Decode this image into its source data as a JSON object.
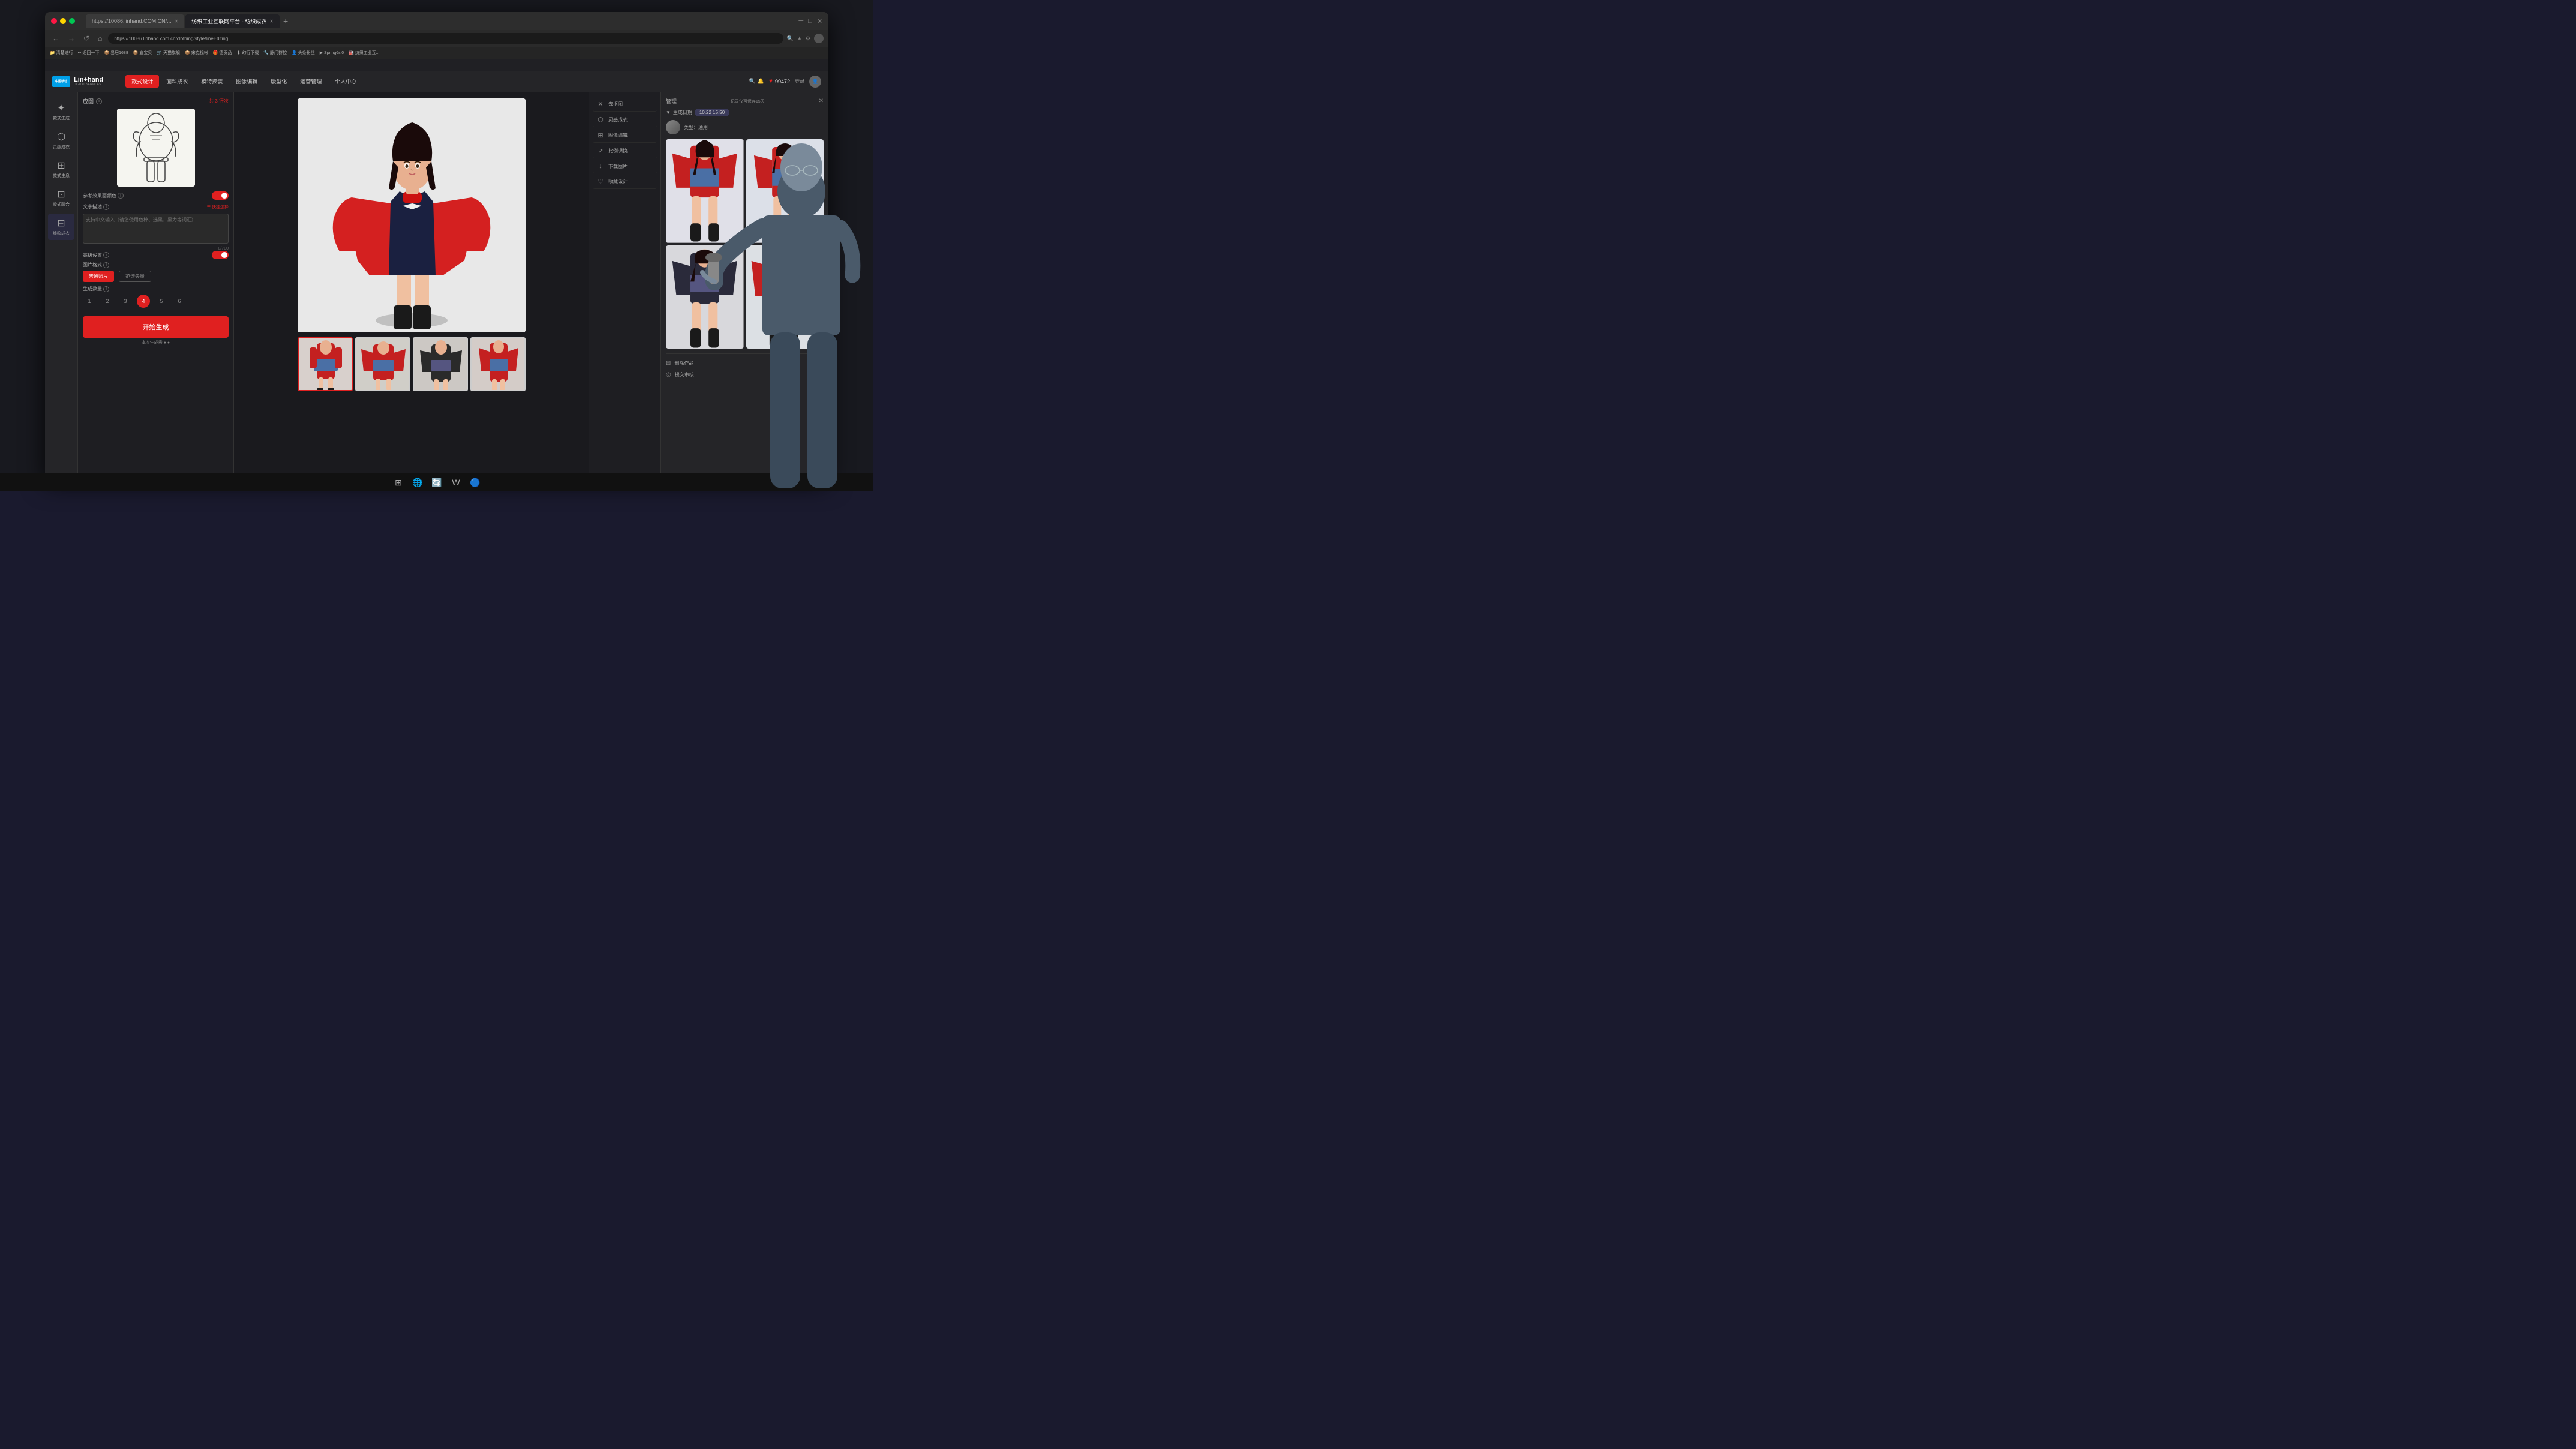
{
  "browser": {
    "tabs": [
      {
        "id": 1,
        "label": "https://10086.linhand.COM.CN/...",
        "active": false
      },
      {
        "id": 2,
        "label": "纺织工业互联网平台 - 纺织成衣",
        "active": true
      },
      {
        "id": 3,
        "label": "",
        "active": false
      }
    ],
    "address": "https://10086.linhand.com.cn/clothing/style/lineEditing",
    "bookmarks": [
      "清除进行",
      "返回一下",
      "易居1688",
      "宜宝贝",
      "天猫旗舰",
      "宋克视帐",
      "德贡品",
      "幻行下载",
      "脉门群控",
      "头条粉丝",
      "Spring6sl0",
      "纺织工业互..."
    ]
  },
  "app": {
    "logo_mobile": "中国移动",
    "logo_name": "Lin+hand",
    "logo_subtitle": "DIGITAL SERVICES",
    "nav_items": [
      {
        "label": "款式设计",
        "active": true
      },
      {
        "label": "面料成衣",
        "active": false
      },
      {
        "label": "模特换装",
        "active": false
      },
      {
        "label": "图像编辑",
        "active": false
      },
      {
        "label": "版型化",
        "active": false
      },
      {
        "label": "运营管理",
        "active": false
      },
      {
        "label": "个人中心",
        "active": false
      }
    ],
    "points": "99472",
    "login_label": "登录"
  },
  "sidebar": {
    "items": [
      {
        "icon": "✦",
        "label": "款式生成",
        "active": false
      },
      {
        "icon": "◈",
        "label": "灵感成衣",
        "active": false
      },
      {
        "icon": "⊞",
        "label": "款式生息",
        "active": false
      },
      {
        "icon": "⊡",
        "label": "款式融合",
        "active": false
      },
      {
        "icon": "⊟",
        "label": "线稿成衣",
        "active": true
      }
    ]
  },
  "left_panel": {
    "section_title": "应图",
    "section_badge": "共 3 行次",
    "color_label": "参考效果面颜色",
    "text_input_label": "文字描述",
    "quick_select_label": "快捷选择",
    "text_placeholder": "支持中文输入（请您使用色棒、选黑、黑力等词汇）",
    "char_count": "0/700",
    "advanced_label": "高级设置",
    "image_format_label": "图片格式",
    "format_options": [
      {
        "label": "普通照片",
        "active": true
      },
      {
        "label": "范透矢量",
        "active": false
      }
    ],
    "gen_count_label": "生成数量",
    "gen_count_options": [
      "1",
      "2",
      "3",
      "4",
      "5",
      "6"
    ],
    "gen_count_active": 4,
    "generate_btn": "开始生成",
    "gen_info": "本次生成需 ● ●"
  },
  "action_panel": {
    "items": [
      {
        "icon": "✕",
        "label": "去抠图"
      },
      {
        "icon": "◈",
        "label": "灵感成衣"
      },
      {
        "icon": "⊞",
        "label": "图像编辑"
      },
      {
        "icon": "↗",
        "label": "比例调换"
      },
      {
        "icon": "↓",
        "label": "下载图片"
      },
      {
        "icon": "♡",
        "label": "收藏设计"
      }
    ]
  },
  "gen_results": {
    "header_label": "管理",
    "save_notice": "记录仅可保存15天",
    "date_label": "生成日期",
    "date_value": "10.22 15:50",
    "model_type_label": "类型：通用",
    "bottom_actions": [
      {
        "icon": "⊟",
        "label": "删除作品"
      },
      {
        "icon": "◎",
        "label": "提交审核"
      }
    ]
  },
  "main_image": {
    "caption": "Fashion model with red jacket outfit"
  },
  "notification": {
    "text": "记录仅可保存15天"
  }
}
